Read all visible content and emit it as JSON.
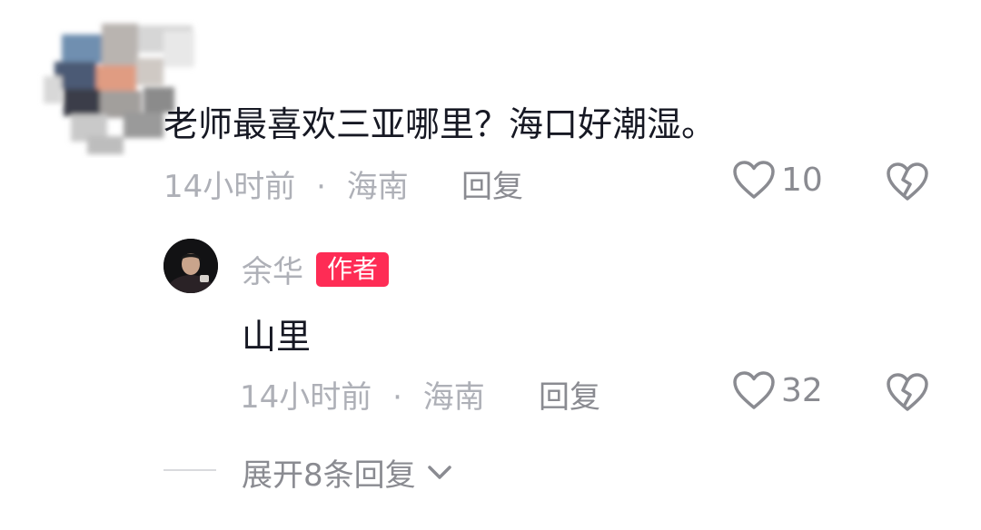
{
  "comment": {
    "text": "老师最喜欢三亚哪里？海口好潮湿。",
    "time": "14小时前",
    "separator": "·",
    "location": "海南",
    "reply_label": "回复",
    "like_count": "10"
  },
  "reply": {
    "author": "余华",
    "badge": "作者",
    "text": "山里",
    "time": "14小时前",
    "separator": "·",
    "location": "海南",
    "reply_label": "回复",
    "like_count": "32"
  },
  "expand_label": "展开8条回复",
  "icons": {
    "like": "heart-outline-icon",
    "dislike": "broken-heart-icon",
    "expand": "chevron-down-icon"
  },
  "colors": {
    "badge": "#fe2c55",
    "primary_text": "#161823",
    "secondary_text": "#aeb0b7"
  }
}
